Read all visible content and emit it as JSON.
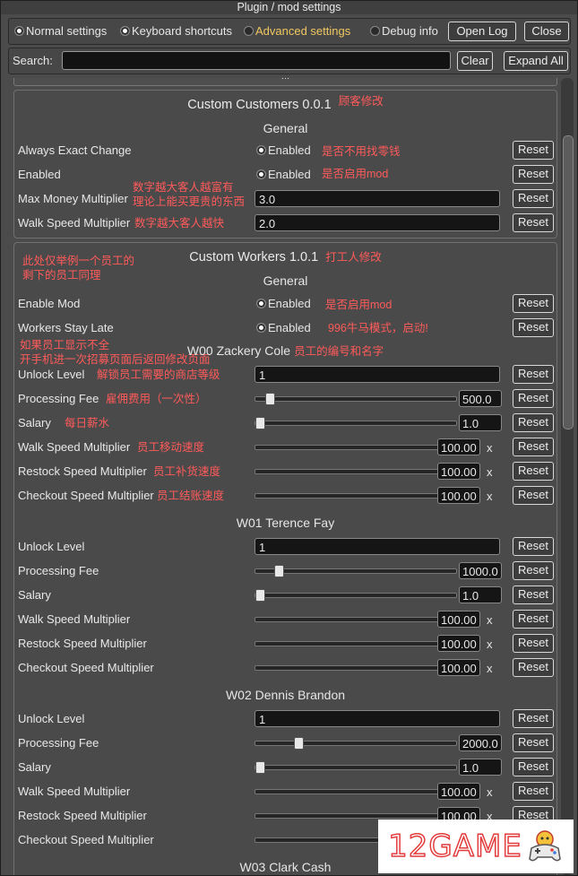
{
  "window": {
    "title": "Plugin / mod settings"
  },
  "tabs": [
    {
      "label": "Normal settings",
      "checked": true
    },
    {
      "label": "Keyboard shortcuts",
      "checked": true
    },
    {
      "label": "Advanced settings",
      "checked": false
    },
    {
      "label": "Debug info",
      "checked": false
    }
  ],
  "toolbar": {
    "open_log": "Open Log",
    "close": "Close"
  },
  "search": {
    "label": "Search:",
    "value": "",
    "clear": "Clear",
    "expand_all": "Expand All"
  },
  "collapsed_marker": "...",
  "reset_label": "Reset",
  "enabled_label": "Enabled",
  "customers": {
    "title": "Custom Customers 0.0.1",
    "title_note": "顾客修改",
    "general": "General",
    "rows": [
      {
        "label": "Always Exact Change",
        "kind": "toggle",
        "on": true,
        "note": "是否不用找零钱"
      },
      {
        "label": "Enabled",
        "kind": "toggle",
        "on": true,
        "note": "是否启用mod"
      },
      {
        "label": "Max Money Multiplier",
        "kind": "field",
        "value": "3.0",
        "note": "数字越大客人越富有\n理论上能买更贵的东西"
      },
      {
        "label": "Walk Speed Multiplier",
        "kind": "field",
        "value": "2.0",
        "note": "数字越大客人越快"
      }
    ]
  },
  "workers": {
    "title": "Custom Workers 1.0.1",
    "title_note": "打工人修改",
    "side_note": "此处仅举例一个员工的\n剩下的员工同理",
    "general": "General",
    "general_rows": [
      {
        "label": "Enable Mod",
        "on": true,
        "note": "是否启用mod"
      },
      {
        "label": "Workers Stay Late",
        "on": true,
        "note": "996牛马模式，启动!"
      }
    ],
    "display_note": "如果员工显示不全\n开手机进一次招募页面后返回修改页面",
    "employees": [
      {
        "name": "W00 Zackery Cole",
        "name_note": "员工的编号和名字",
        "rows": [
          {
            "label": "Unlock Level",
            "kind": "field",
            "value": "1",
            "note": "解锁员工需要的商店等级"
          },
          {
            "label": "Processing Fee",
            "kind": "slider",
            "value": "500.0",
            "fraction": 0.05,
            "note": "雇佣费用（一次性）"
          },
          {
            "label": "Salary",
            "kind": "slider",
            "value": "1.0",
            "fraction": 0.0,
            "note": "每日薪水"
          },
          {
            "label": "Walk Speed Multiplier",
            "kind": "slider_x",
            "value": "100.00",
            "fraction": 1.0,
            "note": "员工移动速度"
          },
          {
            "label": "Restock Speed Multiplier",
            "kind": "slider_x",
            "value": "100.00",
            "fraction": 1.0,
            "note": "员工补货速度"
          },
          {
            "label": "Checkout Speed Multiplier",
            "kind": "slider_x",
            "value": "100.00",
            "fraction": 1.0,
            "note": "员工结账速度"
          }
        ]
      },
      {
        "name": "W01 Terence Fay",
        "rows": [
          {
            "label": "Unlock Level",
            "kind": "field",
            "value": "1"
          },
          {
            "label": "Processing Fee",
            "kind": "slider",
            "value": "1000.0",
            "fraction": 0.1
          },
          {
            "label": "Salary",
            "kind": "slider",
            "value": "1.0",
            "fraction": 0.0
          },
          {
            "label": "Walk Speed Multiplier",
            "kind": "slider_x",
            "value": "100.00",
            "fraction": 1.0
          },
          {
            "label": "Restock Speed Multiplier",
            "kind": "slider_x",
            "value": "100.00",
            "fraction": 1.0
          },
          {
            "label": "Checkout Speed Multiplier",
            "kind": "slider_x",
            "value": "100.00",
            "fraction": 1.0
          }
        ]
      },
      {
        "name": "W02 Dennis Brandon",
        "rows": [
          {
            "label": "Unlock Level",
            "kind": "field",
            "value": "1"
          },
          {
            "label": "Processing Fee",
            "kind": "slider",
            "value": "2000.0",
            "fraction": 0.2
          },
          {
            "label": "Salary",
            "kind": "slider",
            "value": "1.0",
            "fraction": 0.0
          },
          {
            "label": "Walk Speed Multiplier",
            "kind": "slider_x",
            "value": "100.00",
            "fraction": 1.0
          },
          {
            "label": "Restock Speed Multiplier",
            "kind": "slider_x",
            "value": "100.00",
            "fraction": 1.0
          },
          {
            "label": "Checkout Speed Multiplier",
            "kind": "slider_x",
            "value": "100.00",
            "fraction": 1.0
          }
        ]
      },
      {
        "name": "W03 Clark Cash",
        "rows": []
      }
    ]
  },
  "watermark": {
    "text": "12GAME",
    "icon": "gamepad-icon"
  }
}
